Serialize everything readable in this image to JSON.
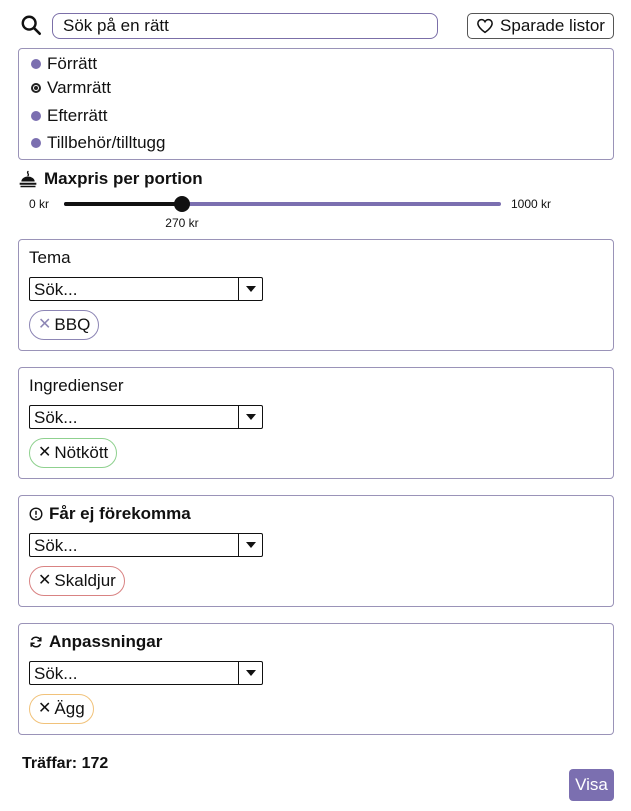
{
  "search": {
    "placeholder": "Sök på en rätt",
    "icon": "search-icon"
  },
  "saved_lists": {
    "label": "Sparade listor",
    "icon": "heart-icon"
  },
  "courses": [
    {
      "label": "Förrätt",
      "selected": false
    },
    {
      "label": "Varmrätt",
      "selected": true
    },
    {
      "label": "Efterrätt",
      "selected": false
    },
    {
      "label": "Tillbehör/tilltugg",
      "selected": false
    }
  ],
  "price": {
    "title": "Maxpris per portion",
    "icon": "serving-dish-icon",
    "min_label": "0 kr",
    "max_label": "1000 kr",
    "min": 0,
    "max": 1000,
    "value": 270,
    "value_label": "270 kr"
  },
  "panels": {
    "tema": {
      "title": "Tema",
      "select_value": "Sök...",
      "chip": {
        "label": "BBQ",
        "color": "#8d86b5",
        "x_color": "#8d86b5"
      }
    },
    "ingredienser": {
      "title": "Ingredienser",
      "select_value": "Sök...",
      "chip": {
        "label": "Nötkött",
        "color": "#8fd18f",
        "x_color": "#111111"
      }
    },
    "exclude": {
      "title": "Får ej förekomma",
      "icon": "warning-circle-icon",
      "select_value": "Sök...",
      "chip": {
        "label": "Skaldjur",
        "color": "#d98383",
        "x_color": "#111111"
      }
    },
    "anpassningar": {
      "title": "Anpassningar",
      "icon": "refresh-icon",
      "select_value": "Sök...",
      "chip": {
        "label": "Ägg",
        "color": "#f1c27a",
        "x_color": "#111111"
      }
    }
  },
  "hits": {
    "text": "Träffar: 172"
  },
  "visa_button": {
    "label": "Visa"
  },
  "colors": {
    "accent": "#7b6fb0",
    "border": "#9a93b8"
  }
}
